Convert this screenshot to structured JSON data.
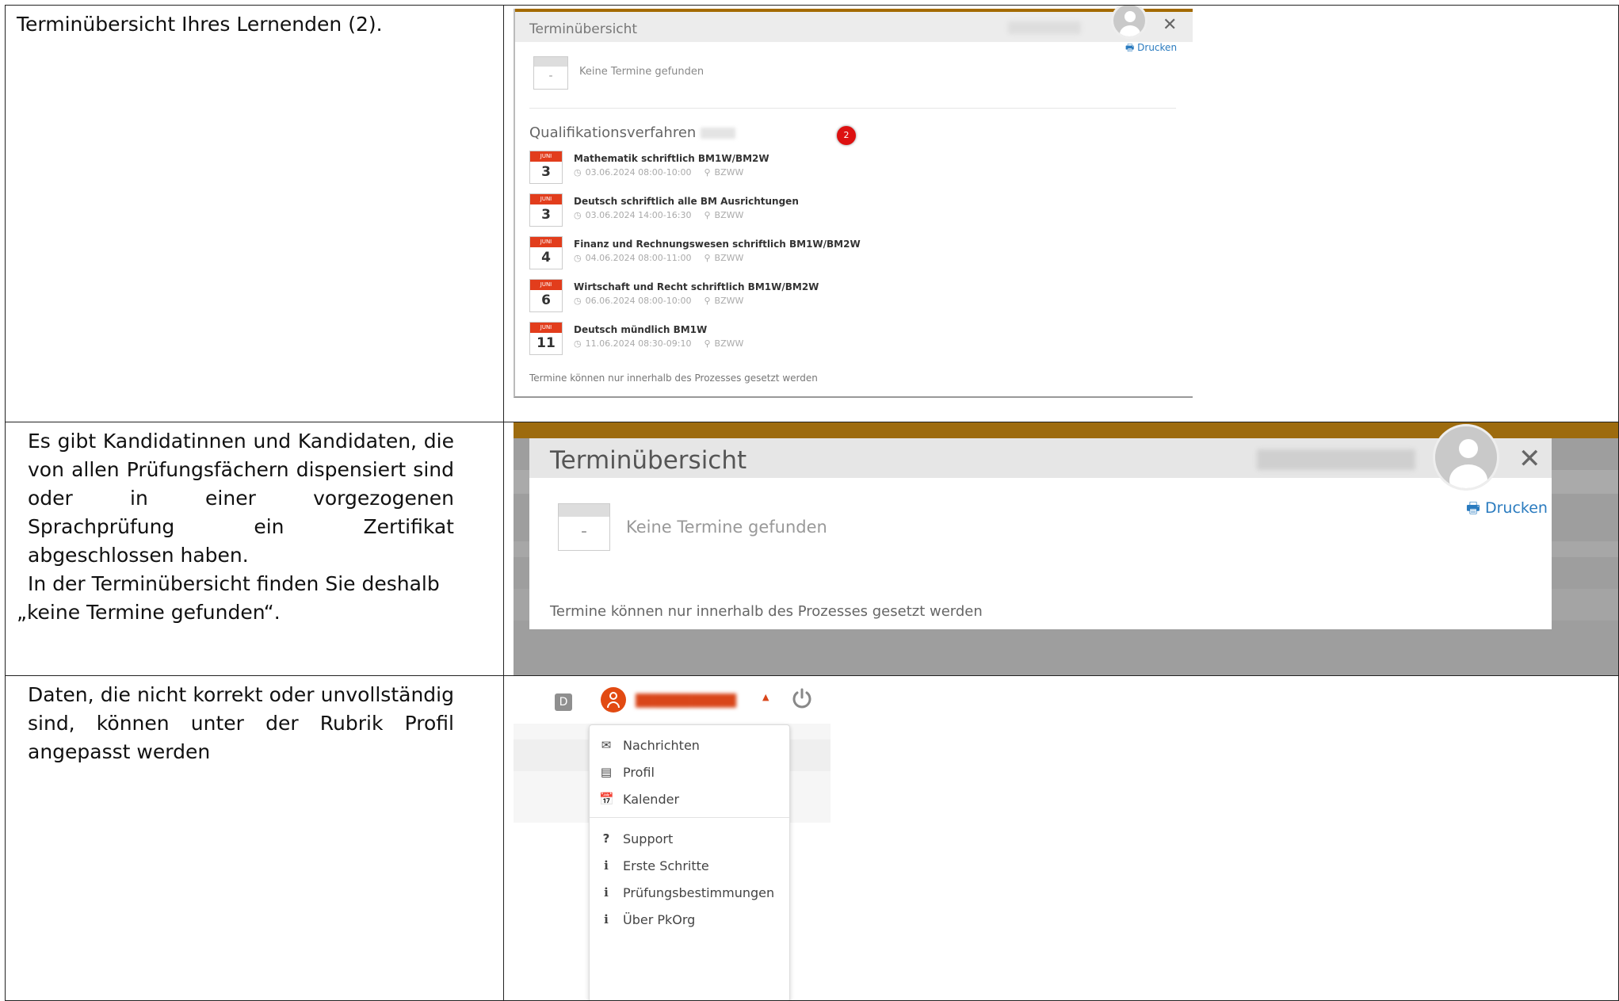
{
  "rows": [
    {
      "text": "Terminübersicht Ihres Lernenden (2).",
      "screenshot": {
        "modal_title": "Terminübersicht",
        "print_label": "Drucken",
        "no_events": "Keine Termine gefunden",
        "section_title": "Qualifikationsverfahren",
        "badge": "2",
        "events": [
          {
            "month": "JUNI",
            "day": "3",
            "title": "Mathematik schriftlich BM1W/BM2W",
            "time": "03.06.2024 08:00-10:00",
            "location": "BZWW"
          },
          {
            "month": "JUNI",
            "day": "3",
            "title": "Deutsch schriftlich alle BM Ausrichtungen",
            "time": "03.06.2024 14:00-16:30",
            "location": "BZWW"
          },
          {
            "month": "JUNI",
            "day": "4",
            "title": "Finanz und Rechnungswesen schriftlich BM1W/BM2W",
            "time": "04.06.2024 08:00-11:00",
            "location": "BZWW"
          },
          {
            "month": "JUNI",
            "day": "6",
            "title": "Wirtschaft und Recht schriftlich BM1W/BM2W",
            "time": "06.06.2024 08:00-10:00",
            "location": "BZWW"
          },
          {
            "month": "JUNI",
            "day": "11",
            "title": "Deutsch mündlich BM1W",
            "time": "11.06.2024 08:30-09:10",
            "location": "BZWW"
          }
        ],
        "footer": "Termine können nur innerhalb des Prozesses gesetzt werden"
      }
    },
    {
      "text_lines": [
        "Es gibt Kandidatinnen und Kandidaten, die von allen Prüfungsfächern dispensiert sind oder in einer vorgezogenen Sprachprüfung ein Zertifikat abgeschlossen haben.",
        "In der Terminübersicht finden Sie deshalb",
        "„keine Termine gefunden“."
      ],
      "screenshot": {
        "modal_title": "Terminübersicht",
        "print_label": "Drucken",
        "no_events": "Keine Termine gefunden",
        "footer": "Termine können nur innerhalb des Prozesses gesetzt werden"
      }
    },
    {
      "text": "Daten, die nicht korrekt oder unvollständig sind, können unter der Rubrik Profil angepasst werden",
      "screenshot": {
        "d_label": "D",
        "menu": [
          {
            "icon": "envelope-icon",
            "label": "Nachrichten"
          },
          {
            "icon": "id-card-icon",
            "label": "Profil"
          },
          {
            "icon": "calendar-icon",
            "label": "Kalender"
          },
          {
            "icon": "question-icon",
            "label": "Support"
          },
          {
            "icon": "info-icon",
            "label": "Erste Schritte"
          },
          {
            "icon": "info-icon",
            "label": "Prüfungsbestimmungen"
          },
          {
            "icon": "info-icon",
            "label": "Über PkOrg"
          }
        ]
      }
    }
  ]
}
